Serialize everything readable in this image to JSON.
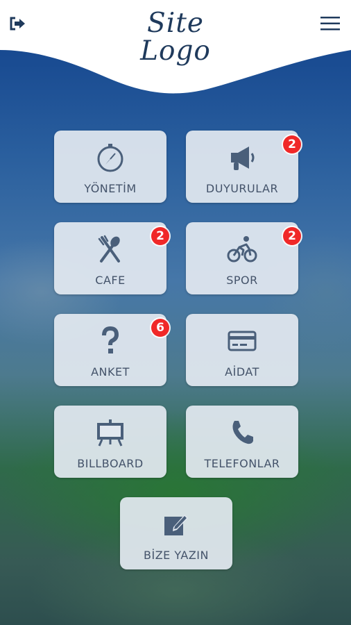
{
  "header": {
    "logo_line1": "Site",
    "logo_line2": "Logo"
  },
  "icons": {
    "exit": "sign-out-icon",
    "menu": "hamburger-menu-icon"
  },
  "colors": {
    "icon": "#4a5f7a",
    "label": "#44536a",
    "badge": "#f02828",
    "logo": "#1f3a5c"
  },
  "tiles": [
    {
      "label": "YÖNETİM",
      "icon": "compass-icon",
      "badge": null
    },
    {
      "label": "DUYURULAR",
      "icon": "megaphone-icon",
      "badge": "2"
    },
    {
      "label": "CAFE",
      "icon": "cutlery-icon",
      "badge": "2"
    },
    {
      "label": "SPOR",
      "icon": "cyclist-icon",
      "badge": "2"
    },
    {
      "label": "ANKET",
      "icon": "question-icon",
      "badge": "6"
    },
    {
      "label": "AİDAT",
      "icon": "credit-card-icon",
      "badge": null
    },
    {
      "label": "BILLBOARD",
      "icon": "easel-icon",
      "badge": null
    },
    {
      "label": "TELEFONLAR",
      "icon": "phone-icon",
      "badge": null
    },
    {
      "label": "BİZE YAZIN",
      "icon": "edit-icon",
      "badge": null
    }
  ]
}
